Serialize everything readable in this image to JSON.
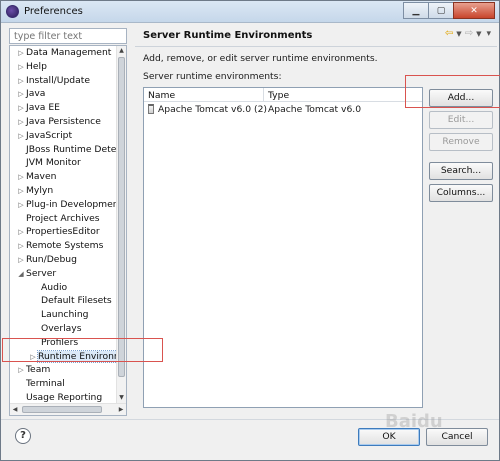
{
  "window": {
    "title": "Preferences"
  },
  "filter": {
    "placeholder": "type filter text"
  },
  "tree": {
    "items": [
      {
        "label": "Data Management",
        "level": 0,
        "arrow": "▷"
      },
      {
        "label": "Help",
        "level": 0,
        "arrow": "▷"
      },
      {
        "label": "Install/Update",
        "level": 0,
        "arrow": "▷"
      },
      {
        "label": "Java",
        "level": 0,
        "arrow": "▷"
      },
      {
        "label": "Java EE",
        "level": 0,
        "arrow": "▷"
      },
      {
        "label": "Java Persistence",
        "level": 0,
        "arrow": "▷"
      },
      {
        "label": "JavaScript",
        "level": 0,
        "arrow": "▷"
      },
      {
        "label": "JBoss Runtime Detect",
        "level": 0,
        "arrow": ""
      },
      {
        "label": "JVM Monitor",
        "level": 0,
        "arrow": ""
      },
      {
        "label": "Maven",
        "level": 0,
        "arrow": "▷"
      },
      {
        "label": "Mylyn",
        "level": 0,
        "arrow": "▷"
      },
      {
        "label": "Plug-in Development",
        "level": 0,
        "arrow": "▷"
      },
      {
        "label": "Project Archives",
        "level": 0,
        "arrow": ""
      },
      {
        "label": "PropertiesEditor",
        "level": 0,
        "arrow": "▷"
      },
      {
        "label": "Remote Systems",
        "level": 0,
        "arrow": "▷"
      },
      {
        "label": "Run/Debug",
        "level": 0,
        "arrow": "▷"
      },
      {
        "label": "Server",
        "level": 0,
        "arrow": "◢"
      },
      {
        "label": "Audio",
        "level": 1,
        "arrow": ""
      },
      {
        "label": "Default Filesets",
        "level": 1,
        "arrow": ""
      },
      {
        "label": "Launching",
        "level": 1,
        "arrow": ""
      },
      {
        "label": "Overlays",
        "level": 1,
        "arrow": ""
      },
      {
        "label": "Profilers",
        "level": 1,
        "arrow": ""
      },
      {
        "label": "Runtime Environm",
        "level": 1,
        "arrow": "▷",
        "selected": true
      },
      {
        "label": "Team",
        "level": 0,
        "arrow": "▷"
      },
      {
        "label": "Terminal",
        "level": 0,
        "arrow": ""
      },
      {
        "label": "Usage Reporting",
        "level": 0,
        "arrow": ""
      }
    ]
  },
  "page": {
    "title": "Server Runtime Environments",
    "description": "Add, remove, or edit server runtime environments.",
    "list_label": "Server runtime environments:",
    "columns": [
      "Name",
      "Type"
    ],
    "rows": [
      {
        "name": "Apache Tomcat v6.0 (2)",
        "type": "Apache Tomcat v6.0"
      }
    ]
  },
  "buttons": {
    "add": "Add...",
    "edit": "Edit...",
    "remove": "Remove",
    "search": "Search...",
    "columns": "Columns..."
  },
  "footer": {
    "help": "?",
    "ok": "OK",
    "cancel": "Cancel"
  },
  "watermark": "Baidu"
}
